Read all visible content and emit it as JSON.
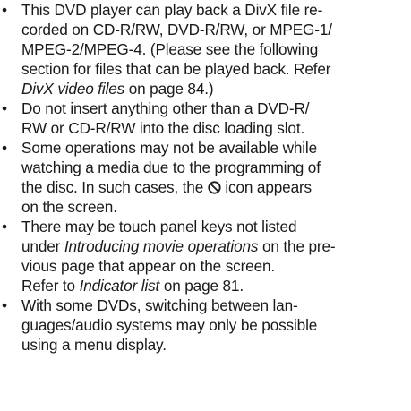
{
  "bullet_glyph": "•",
  "items": [
    {
      "lines": [
        "This DVD player can play back a DivX file re-",
        "corded on CD-R/RW, DVD-R/RW, or MPEG-1/",
        "MPEG-2/MPEG-4. (Please see the following",
        "section for files that can be played back. Refer"
      ],
      "line5_italic": "DivX video files",
      "line5_rest": " on page 84.)"
    },
    {
      "lines": [
        "Do not insert anything other than a DVD-R/",
        "RW or CD-R/RW into the disc loading slot."
      ]
    },
    {
      "lines": [
        "Some operations may not be available while",
        "watching a media due to the programming of"
      ],
      "line3_before": "the disc. In such cases, the ",
      "line3_icon": "prohibit-icon",
      "line3_after": " icon appears",
      "line4": "on the screen."
    },
    {
      "lines": [
        "There may be touch panel keys not listed"
      ],
      "line2_before": "under ",
      "line2_italic": "Introducing movie operations",
      "line2_after": " on the pre-",
      "line3": "vious page that appear on the screen.",
      "line4_before": "Refer to ",
      "line4_italic": "Indicator list",
      "line4_after": " on page 81."
    },
    {
      "lines": [
        "With some DVDs, switching between lan-",
        "guages/audio systems may only be possible",
        "using a menu display."
      ]
    }
  ]
}
